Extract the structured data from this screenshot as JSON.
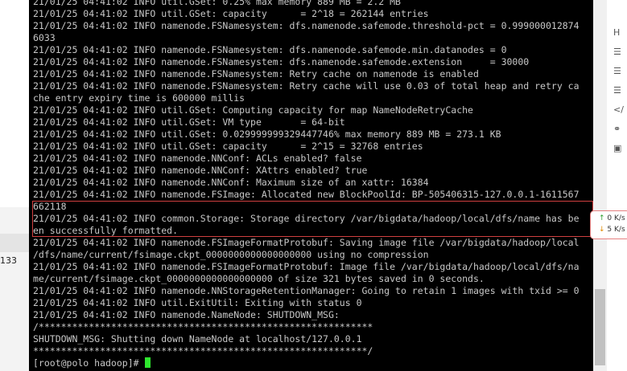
{
  "left_panel": {
    "partial_number": "133"
  },
  "terminal": {
    "lines": [
      "21/01/25 04:41:02 INFO util.GSet: 0.25% max memory 889 MB = 2.2 MB",
      "21/01/25 04:41:02 INFO util.GSet: capacity      = 2^18 = 262144 entries",
      "21/01/25 04:41:02 INFO namenode.FSNamesystem: dfs.namenode.safemode.threshold-pct = 0.999000012874",
      "6033",
      "21/01/25 04:41:02 INFO namenode.FSNamesystem: dfs.namenode.safemode.min.datanodes = 0",
      "21/01/25 04:41:02 INFO namenode.FSNamesystem: dfs.namenode.safemode.extension     = 30000",
      "21/01/25 04:41:02 INFO namenode.FSNamesystem: Retry cache on namenode is enabled",
      "21/01/25 04:41:02 INFO namenode.FSNamesystem: Retry cache will use 0.03 of total heap and retry ca",
      "che entry expiry time is 600000 millis",
      "21/01/25 04:41:02 INFO util.GSet: Computing capacity for map NameNodeRetryCache",
      "21/01/25 04:41:02 INFO util.GSet: VM type       = 64-bit",
      "21/01/25 04:41:02 INFO util.GSet: 0.029999999329447746% max memory 889 MB = 273.1 KB",
      "21/01/25 04:41:02 INFO util.GSet: capacity      = 2^15 = 32768 entries",
      "21/01/25 04:41:02 INFO namenode.NNConf: ACLs enabled? false",
      "21/01/25 04:41:02 INFO namenode.NNConf: XAttrs enabled? true",
      "21/01/25 04:41:02 INFO namenode.NNConf: Maximum size of an xattr: 16384",
      "21/01/25 04:41:02 INFO namenode.FSImage: Allocated new BlockPoolId: BP-505406315-127.0.0.1-1611567",
      "662118",
      "21/01/25 04:41:02 INFO common.Storage: Storage directory /var/bigdata/hadoop/local/dfs/name has be",
      "en successfully formatted.",
      "21/01/25 04:41:02 INFO namenode.FSImageFormatProtobuf: Saving image file /var/bigdata/hadoop/local",
      "/dfs/name/current/fsimage.ckpt_0000000000000000000 using no compression",
      "21/01/25 04:41:02 INFO namenode.FSImageFormatProtobuf: Image file /var/bigdata/hadoop/local/dfs/na",
      "me/current/fsimage.ckpt_0000000000000000000 of size 321 bytes saved in 0 seconds.",
      "21/01/25 04:41:02 INFO namenode.NNStorageRetentionManager: Going to retain 1 images with txid >= 0",
      "21/01/25 04:41:02 INFO util.ExitUtil: Exiting with status 0",
      "21/01/25 04:41:02 INFO namenode.NameNode: SHUTDOWN_MSG:",
      "/************************************************************",
      "SHUTDOWN_MSG: Shutting down NameNode at localhost/127.0.0.1",
      "************************************************************/"
    ],
    "prompt": "[root@polo hadoop]# ",
    "cursor_color": "#2ee62e",
    "highlight_color": "#d04040"
  },
  "right_panel": {
    "icons": [
      "H",
      "list-icon",
      "list-icon",
      "list-icon",
      "code-icon",
      "link-icon",
      "image-icon"
    ]
  },
  "net_widget": {
    "up_arrow": "↑",
    "up_value": "0",
    "up_unit": "K/s",
    "down_arrow": "↓",
    "down_value": "5",
    "down_unit": "K/s"
  }
}
